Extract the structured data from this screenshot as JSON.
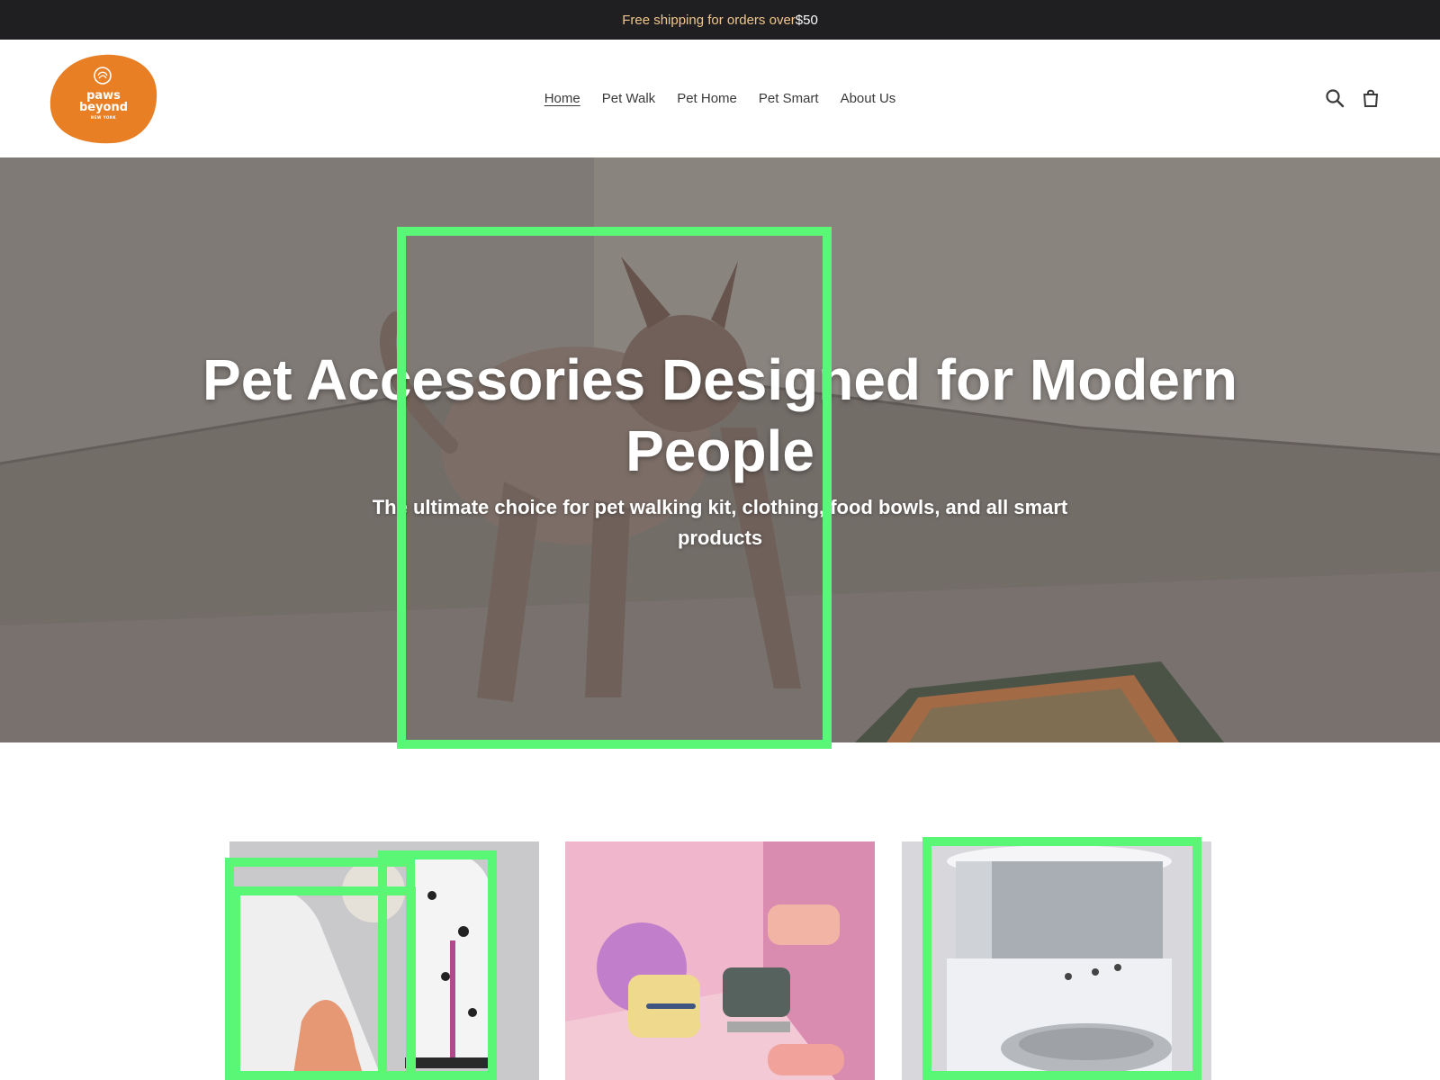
{
  "announcement": {
    "message": "Free shipping for orders over ",
    "amount": "$50"
  },
  "logo": {
    "line1": "paws",
    "line2": "beyond",
    "line3": "NEW YORK",
    "color": "#e87f24"
  },
  "nav": {
    "items": [
      {
        "label": "Home",
        "active": true
      },
      {
        "label": "Pet Walk"
      },
      {
        "label": "Pet Home"
      },
      {
        "label": "Pet Smart"
      },
      {
        "label": "About Us"
      }
    ]
  },
  "icons": {
    "search": "search-icon",
    "cart": "cart-icon"
  },
  "hero": {
    "title": "Pet Accessories Designed for Modern People",
    "subtitle": "The ultimate choice for pet walking kit, clothing, food bowls, and all smart products"
  },
  "collections": [
    {
      "name": "pet-walk"
    },
    {
      "name": "pet-home"
    },
    {
      "name": "pet-smart"
    }
  ],
  "colors": {
    "announcement_bg": "#1f1f22",
    "announcement_text": "#f0c68c",
    "highlight": "#5af777",
    "logo": "#e87f24"
  }
}
